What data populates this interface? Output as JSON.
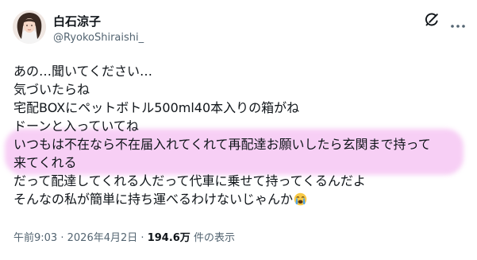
{
  "author": {
    "name": "白石涼子",
    "handle": "@RyokoShiraishi_"
  },
  "post": {
    "lines": [
      "あの…聞いてください…",
      "気づいたらね",
      "宅配BOXにペットボトル500ml40本入りの箱がね",
      "ドーンと入っていてね",
      "いつもは不在なら不在届入れてくれて再配達お願いしたら玄関まで持って",
      "来てくれる",
      "だって配達してくれる人だって代車に乗せて持ってくるんだよ",
      "そんなの私が簡単に持ち運べるわけないじゃんか"
    ],
    "emoji": "crying-face-emoji",
    "highlight_color": "#ec8ce8"
  },
  "meta": {
    "time": "午前9:03",
    "separator": "·",
    "date": "2026年4月2日",
    "views_count": "194.6万",
    "views_label": "件の表示"
  },
  "icons": {
    "grok": "grok-icon",
    "more": "more-icon"
  },
  "colors": {
    "text": "#0f1419",
    "secondary": "#536471",
    "background": "#ffffff"
  }
}
